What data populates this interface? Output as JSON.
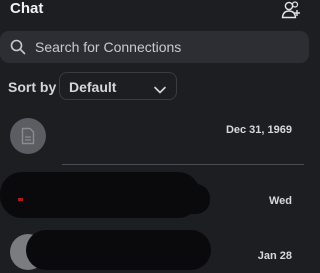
{
  "header": {
    "title": "Chat",
    "add_contact_icon": "add-people-icon"
  },
  "search": {
    "placeholder": "Search for Connections",
    "icon": "search-icon"
  },
  "sort": {
    "label": "Sort by",
    "value": "Default",
    "icon": "chevron-down-icon"
  },
  "conversations": [
    {
      "date": "Dec 31, 1969",
      "avatar": "document-icon"
    },
    {
      "date": "Wed",
      "redacted": true
    },
    {
      "date": "Jan 28",
      "redacted": true
    }
  ],
  "colors": {
    "background": "#1d1e22",
    "search_bg": "#2c2e33",
    "text": "#e8e8ea",
    "divider": "#4a4c52"
  }
}
